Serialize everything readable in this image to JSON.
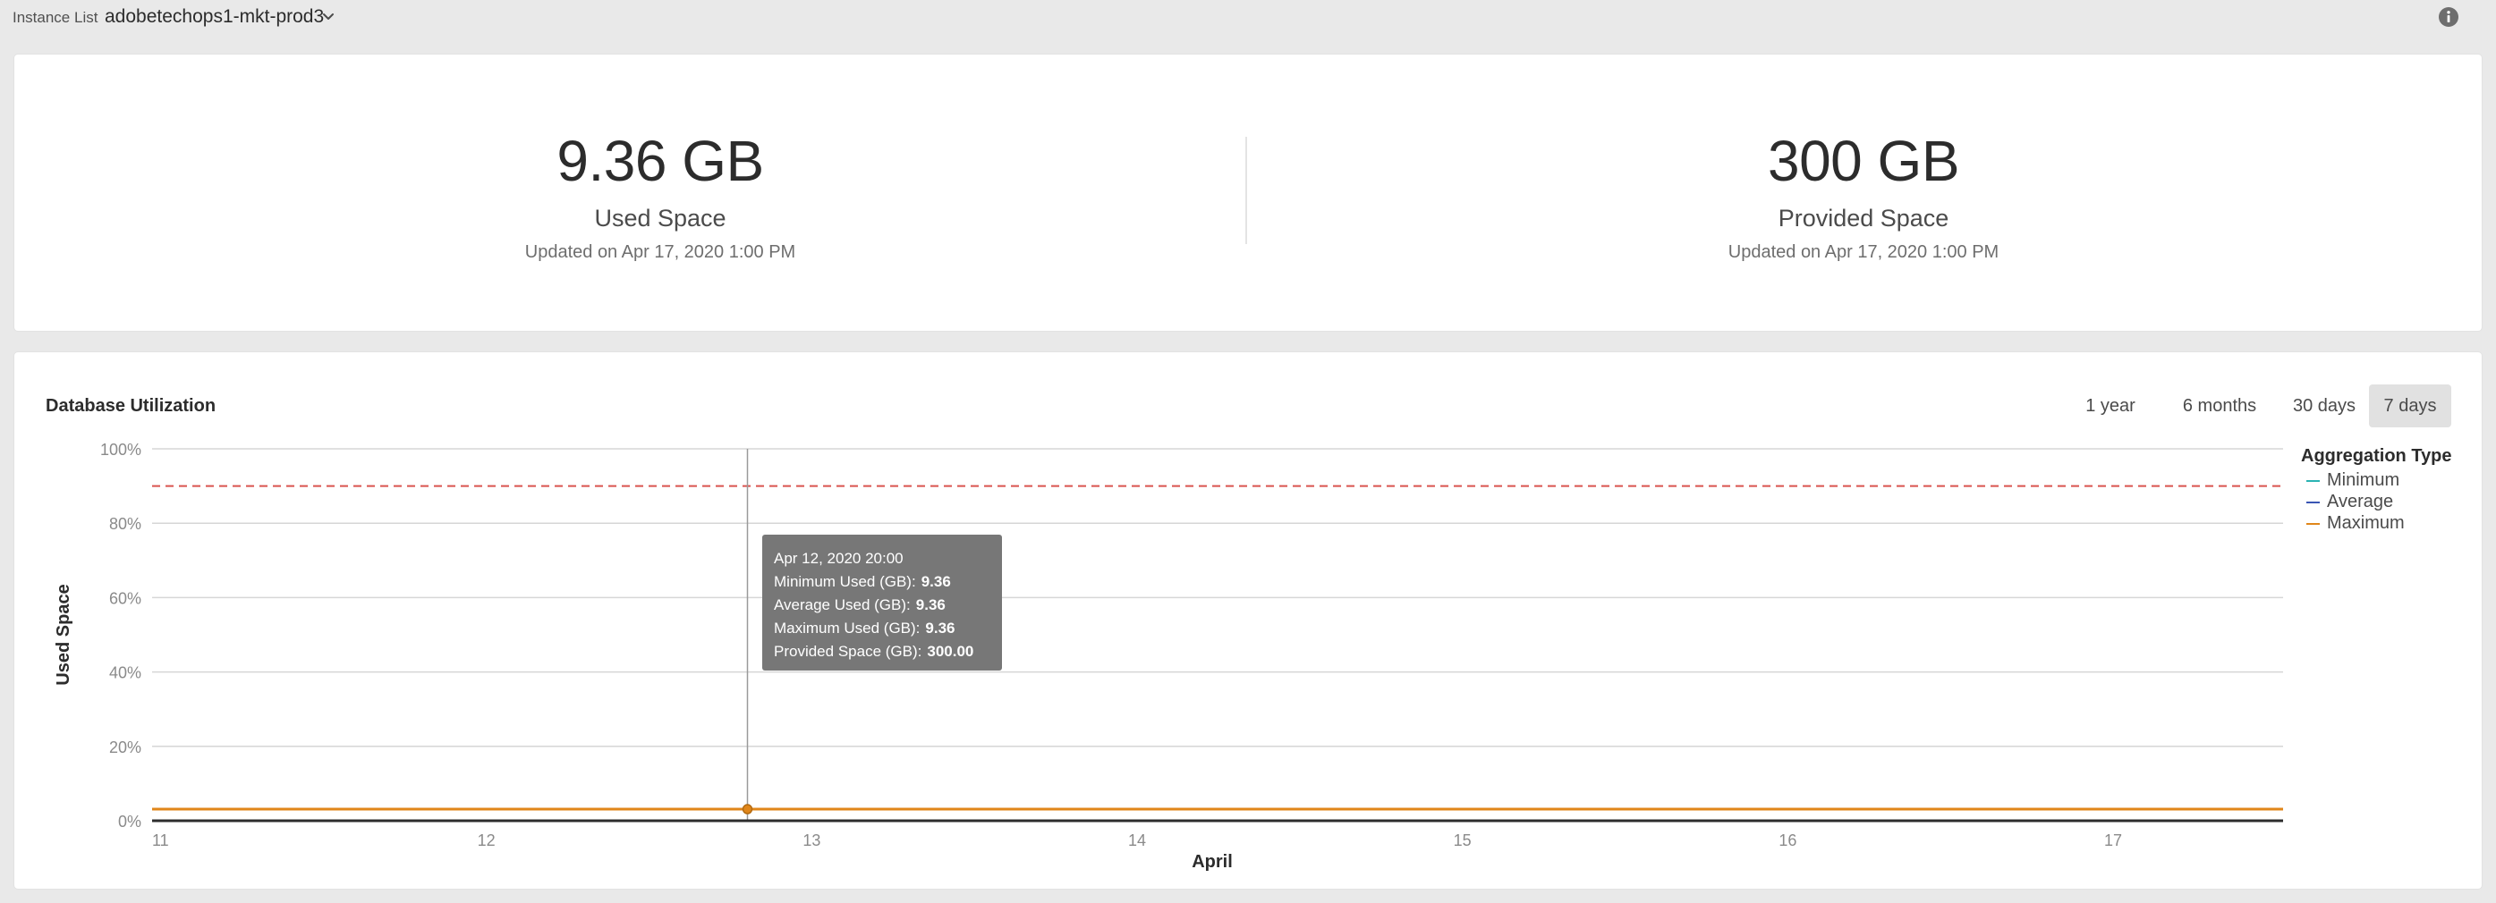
{
  "header": {
    "instance_label": "Instance List",
    "instance_value": "adobetechops1-mkt-prod3"
  },
  "summary": {
    "used": {
      "value": "9.36 GB",
      "label": "Used Space",
      "updated": "Updated on Apr 17, 2020 1:00 PM"
    },
    "provided": {
      "value": "300 GB",
      "label": "Provided Space",
      "updated": "Updated on Apr 17, 2020 1:00 PM"
    }
  },
  "chart_panel": {
    "title": "Database Utilization",
    "ranges": [
      "1 year",
      "6 months",
      "30 days",
      "7 days"
    ],
    "selected_range": "7 days"
  },
  "chart_data": {
    "type": "line",
    "ylabel": "Used Space",
    "xlabel": "April",
    "y_ticks": [
      "0%",
      "20%",
      "40%",
      "60%",
      "80%",
      "100%"
    ],
    "x_ticks": [
      "11",
      "12",
      "13",
      "14",
      "15",
      "16",
      "17"
    ],
    "xlim": [
      11,
      17.55
    ],
    "ylim": [
      0,
      100
    ],
    "grid": true,
    "threshold_percent": 90,
    "legend_title": "Aggregation Type",
    "legend_placement": "right",
    "series": [
      {
        "name": "Minimum",
        "color": "#2bb3b3",
        "value_percent": 3.12
      },
      {
        "name": "Average",
        "color": "#3a55b4",
        "value_percent": 3.12
      },
      {
        "name": "Maximum",
        "color": "#e0861a",
        "value_percent": 3.12
      }
    ],
    "hover_x": 12.83
  },
  "tooltip": {
    "date": "Apr 12, 2020 20:00",
    "rows": [
      {
        "label": "Minimum Used (GB):",
        "value": "9.36"
      },
      {
        "label": "Average Used (GB):",
        "value": "9.36"
      },
      {
        "label": "Maximum Used (GB):",
        "value": "9.36"
      },
      {
        "label": "Provided Space (GB):",
        "value": "300.00"
      }
    ]
  },
  "colors": {
    "threshold": "#d9534f",
    "grid": "#d6d6d6",
    "axis": "#2c2c2c",
    "tooltip_bg": "#777777"
  }
}
